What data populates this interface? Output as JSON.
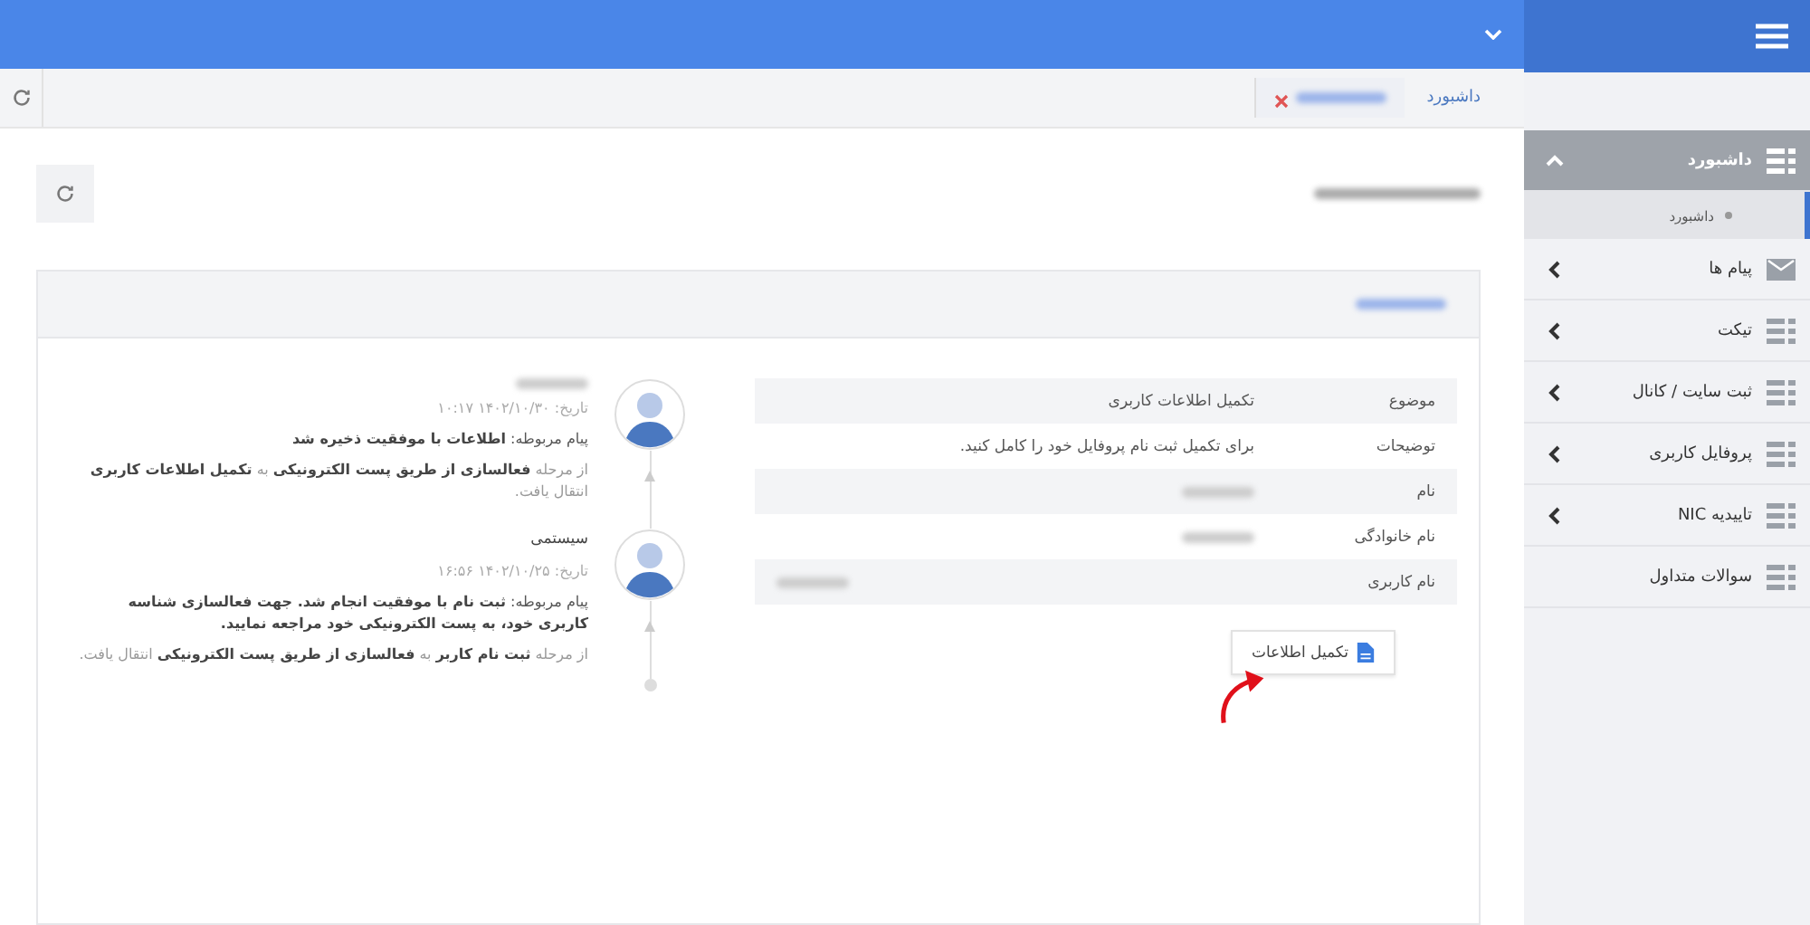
{
  "breadcrumb": {
    "home": "داشبورد"
  },
  "details": [
    {
      "label": "موضوع",
      "value": "تکمیل اطلاعات کاربری",
      "redacted": false
    },
    {
      "label": "توضیحات",
      "value": "برای تکمیل ثبت نام پروفایل خود را کامل کنید.",
      "redacted": false
    },
    {
      "label": "نام",
      "redacted": true
    },
    {
      "label": "نام خانوادگی",
      "redacted": true
    },
    {
      "label": "نام کاربری",
      "redacted": true
    }
  ],
  "action_button": {
    "label": "تکمیل اطلاعات"
  },
  "timeline": [
    {
      "author_redacted": true,
      "date": "تاریخ: ۱۴۰۲/۱۰/۳۰ ۱۰:۱۷",
      "message": "پیام مربوطه: **اطلاعات با موفقیت ذخیره شد**",
      "step": "از مرحله **فعالسازی از طریق پست الکترونیکی** به **تکمیل اطلاعات کاربری** انتقال یافت."
    },
    {
      "author_redacted": false,
      "author": "سیستمی",
      "date": "تاریخ: ۱۴۰۲/۱۰/۲۵ ۱۶:۵۶",
      "message": "پیام مربوطه: **ثبت نام با موفقیت انجام شد. جهت فعالسازی شناسه کاربری خود، به پست الکترونیکی خود مراجعه نمایید.**",
      "step": "از مرحله **ثبت نام کاربر** به **فعالسازی از طریق پست الکترونیکی** انتقال یافت."
    }
  ],
  "sidebar": {
    "items": [
      {
        "label": "داشبورد",
        "kind": "grid",
        "expanded": true,
        "children": [
          {
            "label": "داشبورد",
            "selected": true
          }
        ]
      },
      {
        "label": "پیام ها",
        "kind": "mail",
        "expanded": false
      },
      {
        "label": "تیکت",
        "kind": "grid",
        "expanded": false
      },
      {
        "label": "ثبت سایت / کانال",
        "kind": "grid",
        "expanded": false
      },
      {
        "label": "پروفایل کاربری",
        "kind": "grid",
        "expanded": false
      },
      {
        "label": "تاییدیه NIC",
        "kind": "grid",
        "expanded": false
      },
      {
        "label": "سوالات متداول",
        "kind": "grid",
        "expandable": false
      }
    ]
  }
}
